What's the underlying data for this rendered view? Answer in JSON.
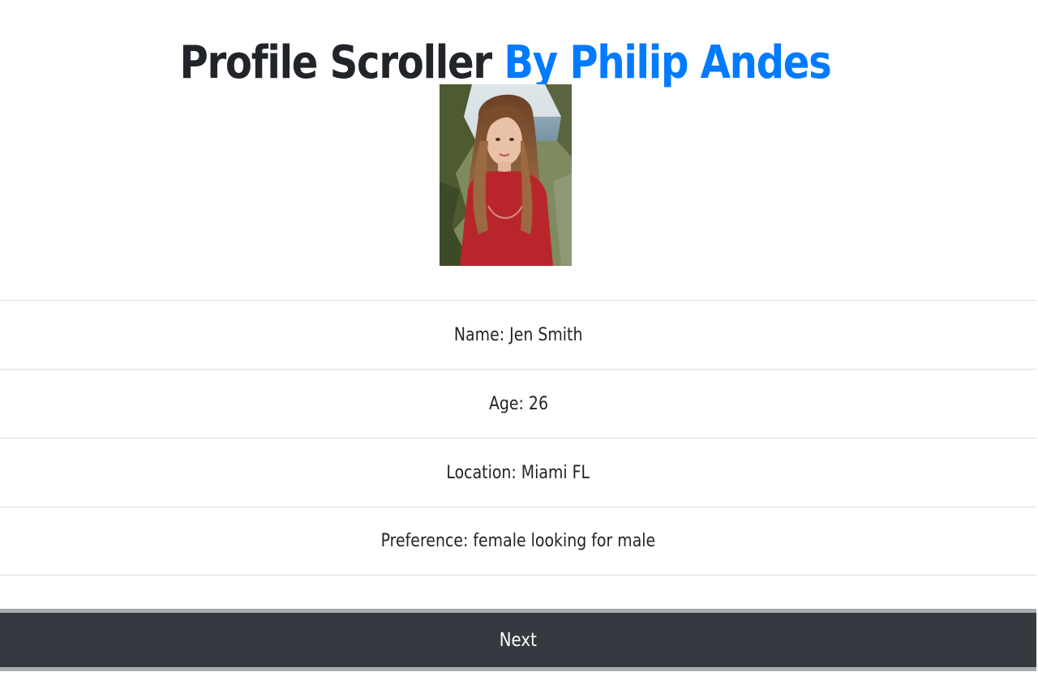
{
  "header": {
    "title_main": "Profile Scroller",
    "title_accent": "By Philip Andes",
    "accent_color": "#007bff"
  },
  "profile": {
    "photo_icon": "profile-photo",
    "name": "Name: Jen Smith",
    "age": "Age: 26",
    "location": "Location: Miami FL",
    "preference": "Preference: female looking for male"
  },
  "actions": {
    "next_label": "Next",
    "next_bg": "#343a40"
  }
}
